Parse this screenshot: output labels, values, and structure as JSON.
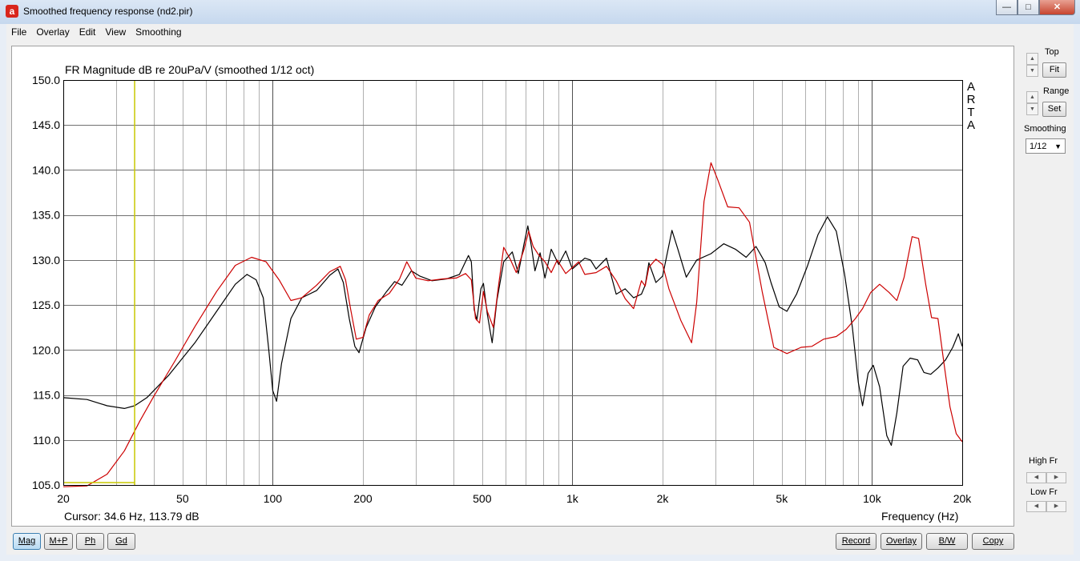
{
  "window": {
    "title": "Smoothed frequency response (nd2.pir)",
    "icon": "arta-app-icon",
    "controls": [
      "minimize",
      "maximize",
      "close"
    ]
  },
  "menu": [
    {
      "label": "File",
      "accel": "F"
    },
    {
      "label": "Overlay",
      "accel": "O"
    },
    {
      "label": "Edit",
      "accel": "E"
    },
    {
      "label": "View",
      "accel": "V"
    },
    {
      "label": "Smoothing",
      "accel": "S"
    }
  ],
  "plot": {
    "title": "FR Magnitude dB re 20uPa/V (smoothed 1/12 oct)",
    "cursor_text": "Cursor: 34.6 Hz, 113.79 dB",
    "x_label": "Frequency (Hz)",
    "watermark": "ARTA",
    "watermark_letters": [
      "A",
      "R",
      "T",
      "A"
    ]
  },
  "chart_data": {
    "type": "line",
    "xscale": "log",
    "xlim": [
      20,
      20000
    ],
    "ylim": [
      105,
      150
    ],
    "grid": true,
    "x_ticks": [
      {
        "value": 20,
        "label": "20"
      },
      {
        "value": 50,
        "label": "50"
      },
      {
        "value": 100,
        "label": "100"
      },
      {
        "value": 200,
        "label": "200"
      },
      {
        "value": 500,
        "label": "500"
      },
      {
        "value": 1000,
        "label": "1k"
      },
      {
        "value": 2000,
        "label": "2k"
      },
      {
        "value": 5000,
        "label": "5k"
      },
      {
        "value": 10000,
        "label": "10k"
      },
      {
        "value": 20000,
        "label": "20k"
      }
    ],
    "y_ticks": [
      "150.0",
      "145.0",
      "140.0",
      "135.0",
      "130.0",
      "125.0",
      "120.0",
      "115.0",
      "110.0",
      "105.0"
    ],
    "y_tick_values": [
      150,
      145,
      140,
      135,
      130,
      125,
      120,
      115,
      110,
      105
    ],
    "cursor": {
      "x": 34.6,
      "y": 113.79,
      "color": "#c8c800"
    },
    "series": [
      {
        "color": "#000000",
        "points": [
          [
            20,
            114.7
          ],
          [
            24,
            114.5
          ],
          [
            28,
            113.8
          ],
          [
            32,
            113.5
          ],
          [
            34.6,
            113.8
          ],
          [
            38,
            114.7
          ],
          [
            45,
            117.2
          ],
          [
            55,
            120.8
          ],
          [
            65,
            124.3
          ],
          [
            75,
            127.3
          ],
          [
            82,
            128.4
          ],
          [
            88,
            127.8
          ],
          [
            93,
            125.8
          ],
          [
            97,
            120
          ],
          [
            100,
            115.5
          ],
          [
            103,
            114.3
          ],
          [
            107,
            118.5
          ],
          [
            115,
            123.5
          ],
          [
            125,
            125.8
          ],
          [
            140,
            126.6
          ],
          [
            155,
            128.3
          ],
          [
            165,
            129
          ],
          [
            172,
            127.5
          ],
          [
            180,
            123.5
          ],
          [
            188,
            120.4
          ],
          [
            194,
            119.7
          ],
          [
            205,
            122.5
          ],
          [
            220,
            124.8
          ],
          [
            240,
            126.5
          ],
          [
            255,
            127.6
          ],
          [
            270,
            127.2
          ],
          [
            290,
            128.8
          ],
          [
            310,
            128.2
          ],
          [
            340,
            127.7
          ],
          [
            380,
            127.9
          ],
          [
            420,
            128.4
          ],
          [
            450,
            130.5
          ],
          [
            460,
            129.8
          ],
          [
            470,
            124.5
          ],
          [
            480,
            123.3
          ],
          [
            495,
            126.8
          ],
          [
            505,
            127.4
          ],
          [
            520,
            124
          ],
          [
            540,
            120.8
          ],
          [
            560,
            125.5
          ],
          [
            590,
            129.8
          ],
          [
            630,
            130.9
          ],
          [
            660,
            128.5
          ],
          [
            690,
            131.8
          ],
          [
            710,
            133.8
          ],
          [
            730,
            131.5
          ],
          [
            750,
            128.8
          ],
          [
            780,
            130.8
          ],
          [
            810,
            128
          ],
          [
            850,
            131.2
          ],
          [
            900,
            129.5
          ],
          [
            950,
            131
          ],
          [
            1000,
            129
          ],
          [
            1100,
            130.2
          ],
          [
            1150,
            130
          ],
          [
            1200,
            129
          ],
          [
            1300,
            130.2
          ],
          [
            1400,
            126.2
          ],
          [
            1500,
            126.8
          ],
          [
            1600,
            125.8
          ],
          [
            1700,
            126.2
          ],
          [
            1750,
            127.2
          ],
          [
            1800,
            129.7
          ],
          [
            1900,
            127.5
          ],
          [
            2000,
            128.2
          ],
          [
            2150,
            133.3
          ],
          [
            2250,
            131.2
          ],
          [
            2400,
            128.1
          ],
          [
            2600,
            130
          ],
          [
            2900,
            130.7
          ],
          [
            3200,
            131.8
          ],
          [
            3500,
            131.2
          ],
          [
            3800,
            130.3
          ],
          [
            4100,
            131.5
          ],
          [
            4400,
            129.7
          ],
          [
            4600,
            127.5
          ],
          [
            4900,
            124.8
          ],
          [
            5200,
            124.3
          ],
          [
            5600,
            126.2
          ],
          [
            6100,
            129.4
          ],
          [
            6600,
            132.8
          ],
          [
            7100,
            134.8
          ],
          [
            7600,
            133.2
          ],
          [
            8100,
            128.4
          ],
          [
            8600,
            122.5
          ],
          [
            9000,
            116.4
          ],
          [
            9300,
            113.8
          ],
          [
            9700,
            117.4
          ],
          [
            10100,
            118.3
          ],
          [
            10600,
            115.9
          ],
          [
            11200,
            110.5
          ],
          [
            11600,
            109.4
          ],
          [
            12100,
            113
          ],
          [
            12700,
            118.2
          ],
          [
            13400,
            119.1
          ],
          [
            14200,
            118.9
          ],
          [
            14900,
            117.5
          ],
          [
            15700,
            117.3
          ],
          [
            16600,
            118
          ],
          [
            17600,
            118.9
          ],
          [
            18600,
            120.3
          ],
          [
            19400,
            121.8
          ],
          [
            20000,
            120.4
          ]
        ]
      },
      {
        "color": "#cc0000",
        "points": [
          [
            20,
            104.8
          ],
          [
            24,
            104.9
          ],
          [
            28,
            106.2
          ],
          [
            32,
            108.8
          ],
          [
            36,
            112.1
          ],
          [
            40,
            114.8
          ],
          [
            47,
            118.7
          ],
          [
            55,
            122.6
          ],
          [
            65,
            126.5
          ],
          [
            75,
            129.4
          ],
          [
            85,
            130.3
          ],
          [
            95,
            129.8
          ],
          [
            105,
            127.8
          ],
          [
            115,
            125.5
          ],
          [
            125,
            125.8
          ],
          [
            140,
            127.2
          ],
          [
            155,
            128.7
          ],
          [
            168,
            129.3
          ],
          [
            175,
            127.8
          ],
          [
            182,
            124.5
          ],
          [
            190,
            121.2
          ],
          [
            200,
            121.4
          ],
          [
            210,
            123.9
          ],
          [
            225,
            125.5
          ],
          [
            245,
            126.3
          ],
          [
            265,
            127.9
          ],
          [
            280,
            129.8
          ],
          [
            300,
            128
          ],
          [
            330,
            127.7
          ],
          [
            370,
            127.9
          ],
          [
            410,
            128
          ],
          [
            440,
            128.5
          ],
          [
            460,
            127.8
          ],
          [
            475,
            123.5
          ],
          [
            490,
            123
          ],
          [
            505,
            126.5
          ],
          [
            520,
            124.3
          ],
          [
            545,
            122.5
          ],
          [
            565,
            126.8
          ],
          [
            590,
            131.4
          ],
          [
            620,
            130.1
          ],
          [
            650,
            128.6
          ],
          [
            690,
            131.2
          ],
          [
            715,
            133.2
          ],
          [
            740,
            131.5
          ],
          [
            770,
            130.6
          ],
          [
            810,
            129.8
          ],
          [
            850,
            128.6
          ],
          [
            890,
            130
          ],
          [
            950,
            128.5
          ],
          [
            1050,
            129.8
          ],
          [
            1100,
            128.4
          ],
          [
            1200,
            128.6
          ],
          [
            1300,
            129.3
          ],
          [
            1400,
            127.7
          ],
          [
            1500,
            125.7
          ],
          [
            1600,
            124.6
          ],
          [
            1700,
            127.7
          ],
          [
            1750,
            127.1
          ],
          [
            1800,
            129.2
          ],
          [
            1900,
            130.1
          ],
          [
            2000,
            129.5
          ],
          [
            2100,
            126.8
          ],
          [
            2300,
            123.3
          ],
          [
            2500,
            120.8
          ],
          [
            2600,
            125.3
          ],
          [
            2750,
            136.5
          ],
          [
            2900,
            140.8
          ],
          [
            3050,
            139
          ],
          [
            3300,
            135.9
          ],
          [
            3600,
            135.8
          ],
          [
            3900,
            134.2
          ],
          [
            4300,
            126.5
          ],
          [
            4700,
            120.3
          ],
          [
            5200,
            119.6
          ],
          [
            5800,
            120.3
          ],
          [
            6300,
            120.4
          ],
          [
            6900,
            121.2
          ],
          [
            7600,
            121.5
          ],
          [
            8200,
            122.3
          ],
          [
            8800,
            123.5
          ],
          [
            9300,
            124.6
          ],
          [
            9900,
            126.4
          ],
          [
            10600,
            127.3
          ],
          [
            11400,
            126.4
          ],
          [
            12100,
            125.5
          ],
          [
            12800,
            128.1
          ],
          [
            13600,
            132.6
          ],
          [
            14300,
            132.4
          ],
          [
            15100,
            127.3
          ],
          [
            15800,
            123.6
          ],
          [
            16600,
            123.5
          ],
          [
            17400,
            118.4
          ],
          [
            18200,
            113.7
          ],
          [
            19100,
            110.7
          ],
          [
            20000,
            109.8
          ]
        ]
      }
    ]
  },
  "sidebar": {
    "top_label": "Top",
    "fit_label": "Fit",
    "range_label": "Range",
    "set_label": "Set",
    "smoothing_label": "Smoothing",
    "smoothing_value": "1/12",
    "high_fr_label": "High Fr",
    "low_fr_label": "Low Fr"
  },
  "buttons": {
    "left": [
      {
        "label": "Mag",
        "active": true
      },
      {
        "label": "M+P",
        "active": false
      },
      {
        "label": "Ph",
        "active": false
      },
      {
        "label": "Gd",
        "active": false
      }
    ],
    "right": [
      {
        "label": "Record"
      },
      {
        "label": "Overlay"
      },
      {
        "label": "B/W"
      },
      {
        "label": "Copy"
      }
    ]
  }
}
